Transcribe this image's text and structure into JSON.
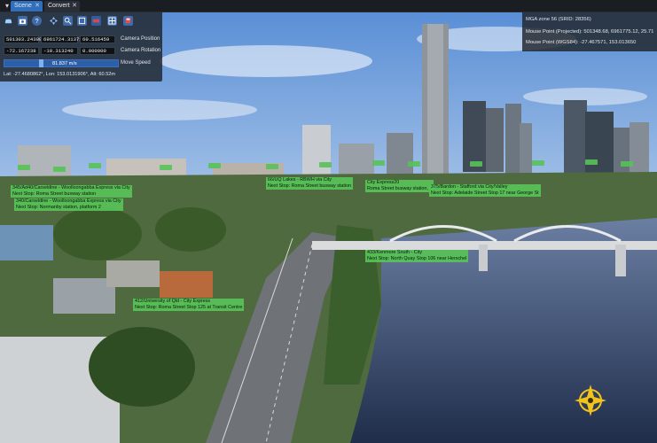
{
  "tabs": [
    {
      "label": "Scene"
    },
    {
      "label": "Convert"
    }
  ],
  "toolbar": {
    "icons": [
      "car-icon",
      "camera-icon",
      "help-icon",
      "move-icon",
      "zoom-icon",
      "fit-icon",
      "local-icon",
      "grid-icon",
      "transit-icon"
    ]
  },
  "camera": {
    "position": [
      "501303.243996",
      "6961724.31371",
      "60.516459"
    ],
    "position_label": "Camera Position",
    "rotation": [
      "-72.167238",
      "-10.313240",
      "0.000000"
    ],
    "rotation_label": "Camera Rotation",
    "speed": "81.837 m/s",
    "speed_label": "Move Speed",
    "speed_fraction": 0.32,
    "latlon": "Lat: -27.4680862°, Lon: 153.0131906°, Alt: 60.52m"
  },
  "info": {
    "crs": "MGA zone 56 (SRID: 28356)",
    "mouse_projected": "Mouse Point (Projected): 501348.68, 6961775.12, 25.71",
    "mouse_wgs84": "Mouse Point (WGS84): -27.467571, 153.013650"
  },
  "labels": [
    {
      "line1": "345/Ad40/Carseldine - Woolloongabba Express via City",
      "line2": "Next Stop: Roma Street busway station"
    },
    {
      "line1": "340/Carseldine - Woolloongabba Express via City",
      "line2": "Next Stop: Normanby station, platform 2"
    },
    {
      "line1": "66/UQ Lakes - RBWH via City",
      "line2": "Next Stop: Roma Street busway station"
    },
    {
      "line1": "City Express20",
      "line2": "Roma Street busway station, 2"
    },
    {
      "line1": "375/Bardon - Stafford via City/Valley",
      "line2": "Next Stop: Adelaide Street Stop 17 near George St"
    },
    {
      "line1": "412/University of Qld - City Express",
      "line2": "Next Stop: Roma Street Stop 125 at Transit Centre"
    },
    {
      "line1": "433/Kenmore South - City",
      "line2": "Next Stop: North Quay Stop 106 near Herschel"
    }
  ],
  "colors": {
    "accent": "#2f6fbd",
    "label": "#58c258",
    "panel": "#20242a"
  }
}
